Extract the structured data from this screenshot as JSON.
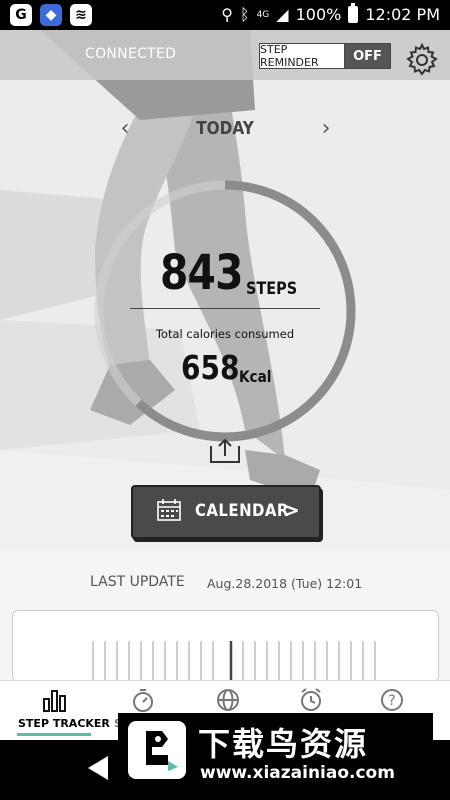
{
  "status_bar": {
    "apps": [
      "G",
      "",
      ""
    ],
    "network": "4G",
    "battery": "100%",
    "time": "12:02 PM"
  },
  "header": {
    "connection_status": "CONNECTED",
    "step_reminder_label": "STEP REMINDER",
    "step_reminder_value": "OFF"
  },
  "date_nav": {
    "prev": "‹",
    "label": "TODAY",
    "next": "›"
  },
  "summary": {
    "steps": "843",
    "steps_unit": "STEPS",
    "calories_label": "Total calories consumed",
    "calories": "658",
    "calories_unit": "Kcal",
    "goal_progress": 0.62
  },
  "calendar_button": {
    "label": "CALENDAR",
    "chevron": ">"
  },
  "last_update": {
    "label": "LAST UPDATE",
    "value": "Aug.28.2018 (Tue) 12:01"
  },
  "tabs": [
    {
      "label": "STEP TRACKER",
      "icon": "bar-chart-icon",
      "active": true
    },
    {
      "label": "S",
      "icon": "stopwatch-icon",
      "active": false
    },
    {
      "label": "",
      "icon": "globe-icon",
      "active": false
    },
    {
      "label": "",
      "icon": "alarm-clock-icon",
      "active": false
    },
    {
      "label": "",
      "icon": "help-icon",
      "active": false
    }
  ],
  "watermark": {
    "title": "下载鸟资源",
    "url": "www.xiazainiao.com"
  },
  "colors": {
    "accent": "#5bbba8",
    "button_bg": "#4a4a4a",
    "ring": "#8c8c8c"
  }
}
